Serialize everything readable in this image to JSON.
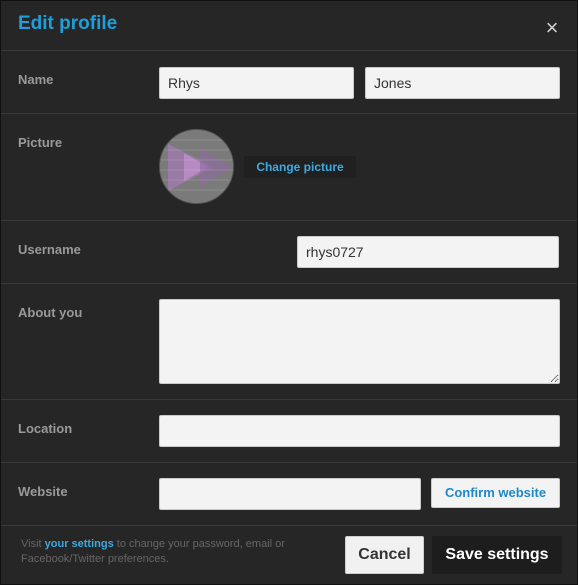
{
  "dialog": {
    "title": "Edit profile",
    "close_icon": "close-icon"
  },
  "fields": {
    "name_label": "Name",
    "first_name": "Rhys",
    "last_name": "Jones",
    "picture_label": "Picture",
    "change_picture": "Change picture",
    "username_label": "Username",
    "username": "rhys0727",
    "about_label": "About you",
    "about": "",
    "location_label": "Location",
    "location": "",
    "website_label": "Website",
    "website": "",
    "confirm_website": "Confirm website"
  },
  "footer": {
    "text_before": "Visit ",
    "link": "your settings",
    "text_after": " to change your password, email or Facebook/Twitter preferences.",
    "cancel": "Cancel",
    "save": "Save settings"
  },
  "colors": {
    "background": "#262626",
    "accent": "#1e9fdc"
  }
}
